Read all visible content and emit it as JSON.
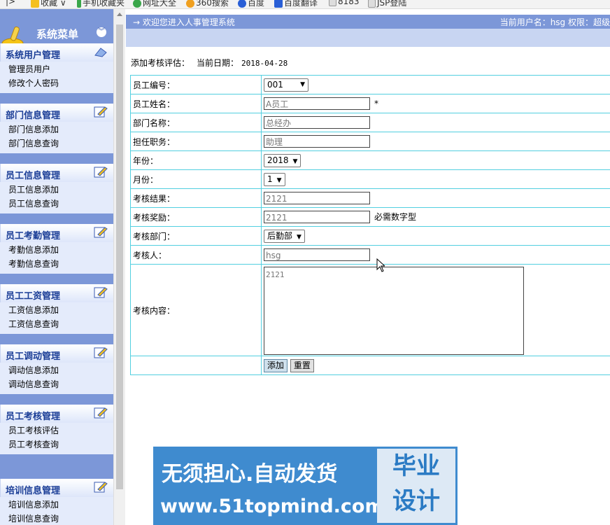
{
  "bookmarks": [
    "收藏",
    "手机收藏夹",
    "网址大全",
    "360搜索",
    "百度",
    "百度翻译",
    "8183",
    "JSP登陆"
  ],
  "sidebar": {
    "title": "系统菜单",
    "groups": [
      {
        "title": "系统用户管理",
        "items": [
          "管理员用户",
          "修改个人密码"
        ]
      },
      {
        "title": "部门信息管理",
        "items": [
          "部门信息添加",
          "部门信息查询"
        ]
      },
      {
        "title": "员工信息管理",
        "items": [
          "员工信息添加",
          "员工信息查询"
        ]
      },
      {
        "title": "员工考勤管理",
        "items": [
          "考勤信息添加",
          "考勤信息查询"
        ]
      },
      {
        "title": "员工工资管理",
        "items": [
          "工资信息添加",
          "工资信息查询"
        ]
      },
      {
        "title": "员工调动管理",
        "items": [
          "调动信息添加",
          "调动信息查询"
        ]
      },
      {
        "title": "员工考核管理",
        "items": [
          "员工考核评估",
          "员工考核查询"
        ]
      },
      {
        "title": "培训信息管理",
        "items": [
          "培训信息添加",
          "培训信息查询"
        ]
      }
    ]
  },
  "topbar": {
    "welcome": "→  欢迎您进入人事管理系统",
    "user_info": "当前用户名：hsg 权限：超级"
  },
  "page": {
    "title": "添加考核评估：",
    "date_label": "当前日期：",
    "date": "2018-04-28"
  },
  "form": {
    "emp_no_label": "员工编号：",
    "emp_no": "001",
    "emp_name_label": "员工姓名：",
    "emp_name": "A员工",
    "required_mark": "*",
    "dept_label": "部门名称：",
    "dept": "总经办",
    "position_label": "担任职务：",
    "position": "助理",
    "year_label": "年份：",
    "year": "2018",
    "month_label": "月份：",
    "month": "1",
    "result_label": "考核结果：",
    "result": "2121",
    "reward_label": "考核奖励：",
    "reward": "2121",
    "reward_hint": "必需数字型",
    "check_dept_label": "考核部门：",
    "check_dept": "后勤部",
    "checker_label": "考核人：",
    "checker": "hsg",
    "content_label": "考核内容：",
    "content": "2121",
    "submit": "添加",
    "reset": "重置"
  },
  "ad": {
    "line1": "无须担心.自动发货",
    "line2": "www.51topmind.com",
    "box_line1": "毕业",
    "box_line2": "设计"
  }
}
